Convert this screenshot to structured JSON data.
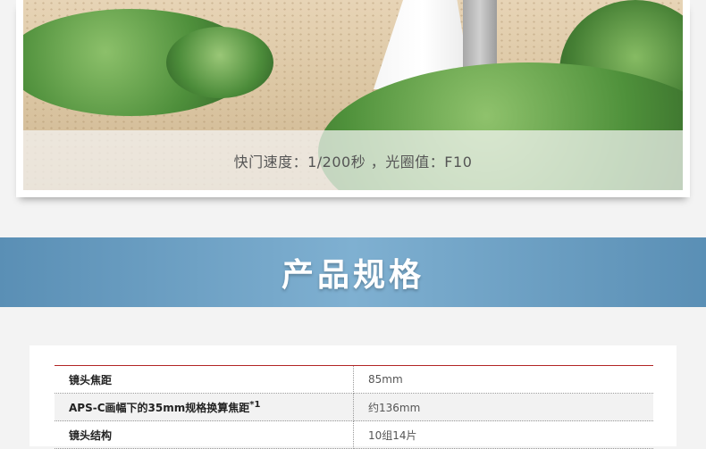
{
  "photo": {
    "caption": "快门速度：1/200秒 ，光圈值：F10"
  },
  "section": {
    "title": "产品规格"
  },
  "specs": {
    "rows": [
      {
        "label": "镜头焦距",
        "note": "",
        "value": "85mm"
      },
      {
        "label": "APS-C画幅下的35mm规格换算焦距",
        "note": "*1",
        "value": "约136mm"
      },
      {
        "label": "镜头结构",
        "note": "",
        "value": "10组14片"
      }
    ]
  },
  "colors": {
    "banner": "#6a9ec3",
    "table_top_rule": "#b22525"
  }
}
